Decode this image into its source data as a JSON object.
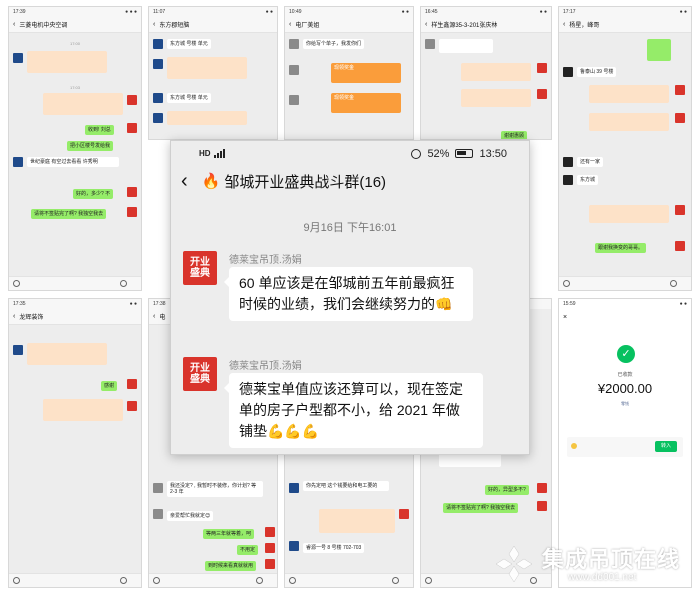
{
  "center": {
    "status_signal": "HD",
    "battery": "52%",
    "clock": "13:50",
    "title": "邹城开业盛典战斗群(16)",
    "fire_icon": "🔥",
    "timestamp": "9月16日 下午16:01",
    "messages": [
      {
        "sender": "德莱宝吊顶.汤娟",
        "avatar_line1": "开业",
        "avatar_line2": "盛典",
        "text": "60 单应该是在邹城前五年前最疯狂时候的业绩，我们会继续努力的👊"
      },
      {
        "sender": "德莱宝吊顶.汤娟",
        "avatar_line1": "开业",
        "avatar_line2": "盛典",
        "text": "德莱宝单值应该还算可以，现在签定单的房子户型都不小，给 2021 年做铺垫💪💪💪"
      }
    ]
  },
  "phones": {
    "p1": {
      "title": "三菱电机中央空调",
      "msgs": [
        "收到! 刘总",
        "把小区楼号发给我",
        "世纪豪庭 有空过去看看 许秀明",
        "好的，多少? 不",
        "嗯啊 在? 有? 刘总",
        "请将不签贴完了啊? 我独空我去"
      ]
    },
    "p2": {
      "title": "东方郡短脑",
      "msgs": [
        "东方城 号楼 单元",
        "东方城 号楼 单元"
      ]
    },
    "p3": {
      "title": "电厂美姐",
      "msgs": [
        "你给写个单子，我发你们",
        "现领奖金",
        "现领奖金"
      ]
    },
    "p4": {
      "title": "样生鑫源35-3-201张庆林",
      "msgs": [
        "谢谢惠顾"
      ]
    },
    "p5": {
      "title": "杨星，峰哥",
      "msgs": [
        "鲁泰山 39 号楼",
        "还有一家",
        "东方城",
        "跟谢我换变的哥哥。"
      ]
    },
    "p6": {
      "title": "龙辉装饰",
      "msgs": [
        "感谢"
      ]
    },
    "p7": {
      "title": "电",
      "msgs": [
        "我还没定? , 我暂时不装修，你计划? 等 2-3 年",
        "亲爱帮忙我就定😊",
        "等两三年就等着，呵",
        "不用定",
        "到时候来看真就就用",
        "😊"
      ]
    },
    "p8": {
      "title": "",
      "msgs": [
        "你先定吧 这个钱要给和电工要的",
        "睿源一号 8 号楼 702-703"
      ]
    },
    "p9": {
      "title": "",
      "msgs": [
        "好的，异型多不?",
        "请将不签贴完了啊? 我独空我去"
      ]
    },
    "p10": {
      "title": "",
      "pay_label": "已收款",
      "pay_amount": "¥2000.00",
      "pay_sub": "零钱",
      "pay_btn": "转入"
    }
  },
  "watermark": {
    "text": "集成吊顶在线",
    "url": "www.dd001.net"
  }
}
